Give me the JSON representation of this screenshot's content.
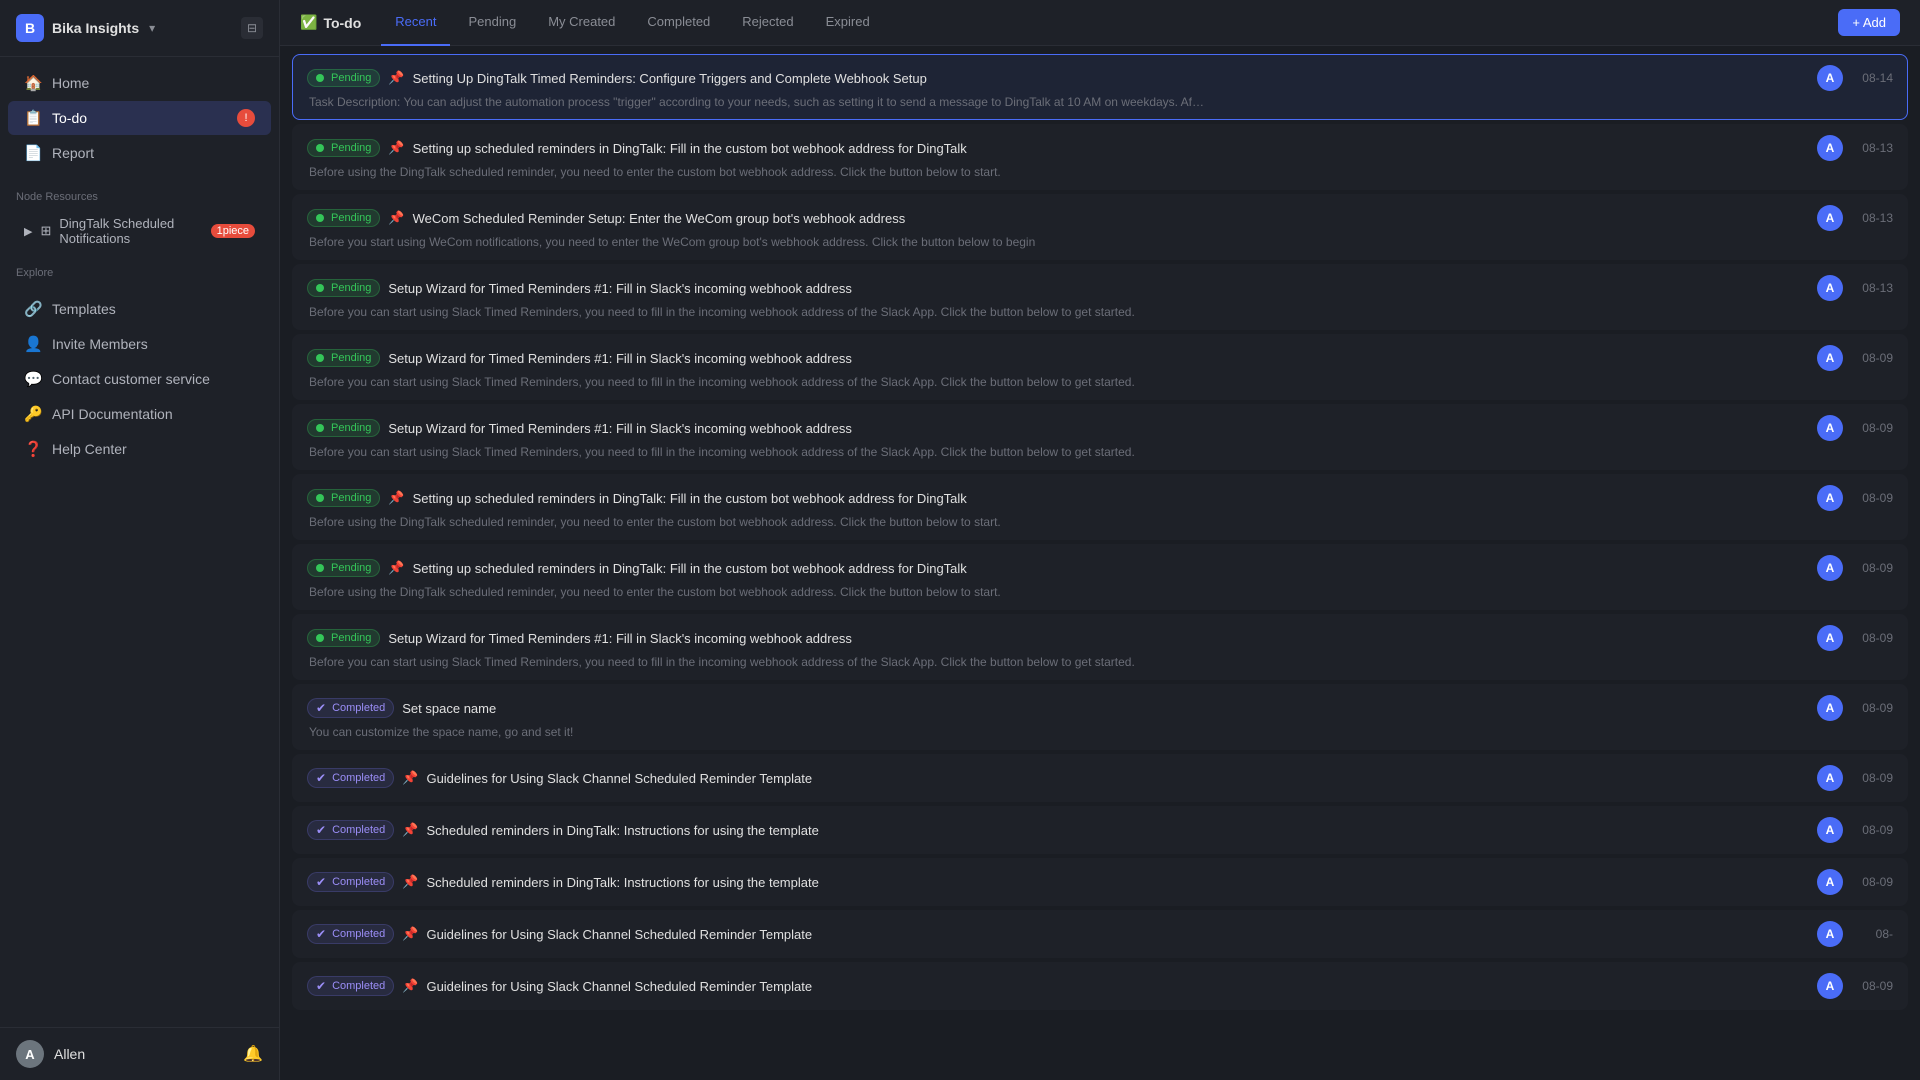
{
  "sidebar": {
    "workspace_icon": "B",
    "workspace_name": "Bika Insights",
    "nav_items": [
      {
        "id": "home",
        "label": "Home",
        "icon": "🏠",
        "badge": null,
        "active": false
      },
      {
        "id": "todo",
        "label": "To-do",
        "icon": "📋",
        "badge": "!",
        "active": true
      },
      {
        "id": "report",
        "label": "Report",
        "icon": "📄",
        "badge": null,
        "active": false
      }
    ],
    "node_resources_label": "Node Resources",
    "node_resources": [
      {
        "id": "dingtalk",
        "label": "DingTalk Scheduled Notifications",
        "badge": "1piece"
      }
    ],
    "explore_label": "Explore",
    "explore_items": [
      {
        "id": "templates",
        "label": "Templates",
        "icon": "🔗"
      },
      {
        "id": "invite",
        "label": "Invite Members",
        "icon": "👤"
      },
      {
        "id": "contact",
        "label": "Contact customer service",
        "icon": "💬"
      },
      {
        "id": "api",
        "label": "API Documentation",
        "icon": "🔑"
      },
      {
        "id": "help",
        "label": "Help Center",
        "icon": "❓"
      }
    ],
    "user": {
      "name": "Allen",
      "avatar": "A"
    }
  },
  "header": {
    "title": "To-do",
    "title_icon": "✅",
    "tabs": [
      {
        "id": "recent",
        "label": "Recent",
        "active": true
      },
      {
        "id": "pending",
        "label": "Pending",
        "active": false
      },
      {
        "id": "my_created",
        "label": "My Created",
        "active": false
      },
      {
        "id": "completed",
        "label": "Completed",
        "active": false
      },
      {
        "id": "rejected",
        "label": "Rejected",
        "active": false
      },
      {
        "id": "expired",
        "label": "Expired",
        "active": false
      }
    ],
    "add_btn": "+ Add"
  },
  "tasks": [
    {
      "id": 1,
      "highlighted": true,
      "badge": "Pending",
      "badge_type": "pending",
      "pin": true,
      "title": "Setting Up DingTalk Timed Reminders: Configure Triggers and Complete Webhook Setup",
      "desc": "Task Description: You can adjust the automation process \"trigger\" according to your needs, such as setting it to send a message to DingTalk at 10 AM on weekdays. After saving the trigger settings, open the \"executor\" and fill in...",
      "avatar": "A",
      "date": "08-14"
    },
    {
      "id": 2,
      "highlighted": false,
      "badge": "Pending",
      "badge_type": "pending",
      "pin": true,
      "title": "Setting up scheduled reminders in DingTalk: Fill in the custom bot webhook address for DingTalk",
      "desc": "Before using the DingTalk scheduled reminder, you need to enter the custom bot webhook address. Click the button below to start.",
      "avatar": "A",
      "date": "08-13"
    },
    {
      "id": 3,
      "highlighted": false,
      "badge": "Pending",
      "badge_type": "pending",
      "pin": true,
      "title": "WeCom Scheduled Reminder Setup: Enter the WeCom group bot's webhook address",
      "desc": "Before you start using WeCom notifications, you need to enter the WeCom group bot's webhook address. Click the button below to begin",
      "avatar": "A",
      "date": "08-13"
    },
    {
      "id": 4,
      "highlighted": false,
      "badge": "Pending",
      "badge_type": "pending",
      "pin": false,
      "title": "Setup Wizard for Timed Reminders #1: Fill in Slack's incoming webhook address",
      "desc": "Before you can start using Slack Timed Reminders, you need to fill in the incoming webhook address of the Slack App. Click the button below to get started.",
      "avatar": "A",
      "date": "08-13"
    },
    {
      "id": 5,
      "highlighted": false,
      "badge": "Pending",
      "badge_type": "pending",
      "pin": false,
      "title": "Setup Wizard for Timed Reminders #1: Fill in Slack's incoming webhook address",
      "desc": "Before you can start using Slack Timed Reminders, you need to fill in the incoming webhook address of the Slack App. Click the button below to get started.",
      "avatar": "A",
      "date": "08-09"
    },
    {
      "id": 6,
      "highlighted": false,
      "badge": "Pending",
      "badge_type": "pending",
      "pin": false,
      "title": "Setup Wizard for Timed Reminders #1: Fill in Slack's incoming webhook address",
      "desc": "Before you can start using Slack Timed Reminders, you need to fill in the incoming webhook address of the Slack App. Click the button below to get started.",
      "avatar": "A",
      "date": "08-09"
    },
    {
      "id": 7,
      "highlighted": false,
      "badge": "Pending",
      "badge_type": "pending",
      "pin": true,
      "title": "Setting up scheduled reminders in DingTalk: Fill in the custom bot webhook address for DingTalk",
      "desc": "Before using the DingTalk scheduled reminder, you need to enter the custom bot webhook address. Click the button below to start.",
      "avatar": "A",
      "date": "08-09"
    },
    {
      "id": 8,
      "highlighted": false,
      "badge": "Pending",
      "badge_type": "pending",
      "pin": true,
      "title": "Setting up scheduled reminders in DingTalk: Fill in the custom bot webhook address for DingTalk",
      "desc": "Before using the DingTalk scheduled reminder, you need to enter the custom bot webhook address. Click the button below to start.",
      "avatar": "A",
      "date": "08-09"
    },
    {
      "id": 9,
      "highlighted": false,
      "badge": "Pending",
      "badge_type": "pending",
      "pin": false,
      "title": "Setup Wizard for Timed Reminders #1: Fill in Slack's incoming webhook address",
      "desc": "Before you can start using Slack Timed Reminders, you need to fill in the incoming webhook address of the Slack App. Click the button below to get started.",
      "avatar": "A",
      "date": "08-09"
    },
    {
      "id": 10,
      "highlighted": false,
      "badge": "Completed",
      "badge_type": "completed",
      "pin": false,
      "title": "Set space name",
      "desc": "You can customize the space name, go and set it!",
      "avatar": "A",
      "date": "08-09"
    },
    {
      "id": 11,
      "highlighted": false,
      "badge": "Completed",
      "badge_type": "completed",
      "pin": true,
      "title": "Guidelines for Using Slack Channel Scheduled Reminder Template",
      "desc": "",
      "avatar": "A",
      "date": "08-09"
    },
    {
      "id": 12,
      "highlighted": false,
      "badge": "Completed",
      "badge_type": "completed",
      "pin": true,
      "title": "Scheduled reminders in DingTalk: Instructions for using the template",
      "desc": "",
      "avatar": "A",
      "date": "08-09"
    },
    {
      "id": 13,
      "highlighted": false,
      "badge": "Completed",
      "badge_type": "completed",
      "pin": true,
      "title": "Scheduled reminders in DingTalk: Instructions for using the template",
      "desc": "",
      "avatar": "A",
      "date": "08-09"
    },
    {
      "id": 14,
      "highlighted": false,
      "badge": "Completed",
      "badge_type": "completed",
      "pin": true,
      "title": "Guidelines for Using Slack Channel Scheduled Reminder Template",
      "desc": "",
      "avatar": "A",
      "date": "08-"
    },
    {
      "id": 15,
      "highlighted": false,
      "badge": "Completed",
      "badge_type": "completed",
      "pin": true,
      "title": "Guidelines for Using Slack Channel Scheduled Reminder Template",
      "desc": "",
      "avatar": "A",
      "date": "08-09"
    }
  ],
  "colors": {
    "accent": "#4a6cf7",
    "pending_green": "#34c759",
    "completed_purple": "#9b8ef7"
  }
}
